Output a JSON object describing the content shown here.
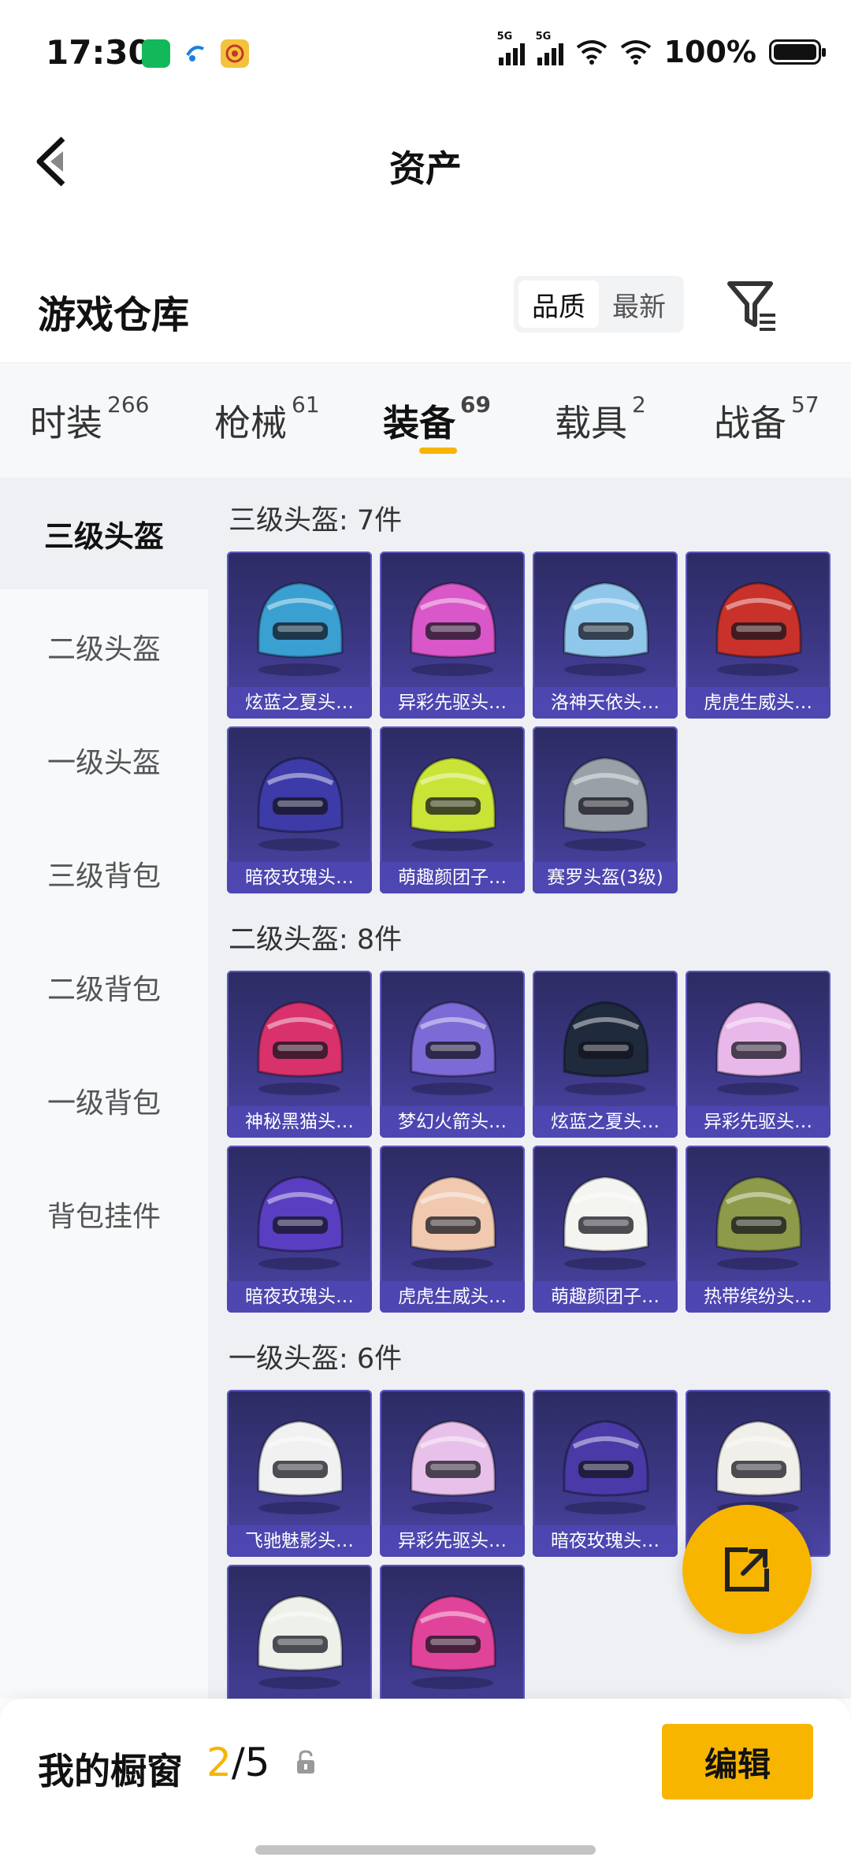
{
  "status": {
    "time": "17:30",
    "net1": "5G",
    "net2": "5G",
    "battery": "100%"
  },
  "header": {
    "title": "资产"
  },
  "warehouse": {
    "title": "游戏仓库",
    "sort_quality": "品质",
    "sort_latest": "最新"
  },
  "tabs": [
    {
      "label": "时装",
      "count": "266"
    },
    {
      "label": "枪械",
      "count": "61"
    },
    {
      "label": "装备",
      "count": "69"
    },
    {
      "label": "载具",
      "count": "2"
    },
    {
      "label": "战备",
      "count": "57"
    }
  ],
  "sidebar": [
    {
      "label": "三级头盔"
    },
    {
      "label": "二级头盔"
    },
    {
      "label": "一级头盔"
    },
    {
      "label": "三级背包"
    },
    {
      "label": "二级背包"
    },
    {
      "label": "一级背包"
    },
    {
      "label": "背包挂件"
    }
  ],
  "sections": [
    {
      "title": "三级头盔: 7件",
      "items": [
        {
          "name": "炫蓝之夏头…",
          "color": "#3a9fd1"
        },
        {
          "name": "异彩先驱头…",
          "color": "#d957c8"
        },
        {
          "name": "洛神天依头…",
          "color": "#8fc7ea"
        },
        {
          "name": "虎虎生威头…",
          "color": "#c8322a"
        },
        {
          "name": "暗夜玫瑰头…",
          "color": "#3c3ba8"
        },
        {
          "name": "萌趣颜团子…",
          "color": "#c9e437"
        },
        {
          "name": "赛罗头盔(3级)",
          "color": "#9aa0a8"
        }
      ]
    },
    {
      "title": "二级头盔: 8件",
      "items": [
        {
          "name": "神秘黑猫头…",
          "color": "#d8316b"
        },
        {
          "name": "梦幻火箭头…",
          "color": "#7c6ad6"
        },
        {
          "name": "炫蓝之夏头…",
          "color": "#1f2a3c"
        },
        {
          "name": "异彩先驱头…",
          "color": "#e9b8ea"
        },
        {
          "name": "暗夜玫瑰头…",
          "color": "#5a3ec2"
        },
        {
          "name": "虎虎生威头…",
          "color": "#f0c9b0"
        },
        {
          "name": "萌趣颜团子…",
          "color": "#f4f4f0"
        },
        {
          "name": "热带缤纷头…",
          "color": "#8c9a4a"
        }
      ]
    },
    {
      "title": "一级头盔: 6件",
      "items": [
        {
          "name": "飞驰魅影头…",
          "color": "#f1f1f1"
        },
        {
          "name": "异彩先驱头…",
          "color": "#e8c1ea"
        },
        {
          "name": "暗夜玫瑰头…",
          "color": "#4a3aa8"
        },
        {
          "name": "",
          "color": "#f1efe9"
        },
        {
          "name": "",
          "color": "#eef1ea"
        },
        {
          "name": "",
          "color": "#e0449a"
        }
      ]
    }
  ],
  "showcase": {
    "label": "我的橱窗",
    "current": "2",
    "total": "/5",
    "edit": "编辑"
  },
  "colors": {
    "accent": "#f7b500",
    "card_top": "#2d2b63",
    "card_bottom": "#4d45a6"
  }
}
